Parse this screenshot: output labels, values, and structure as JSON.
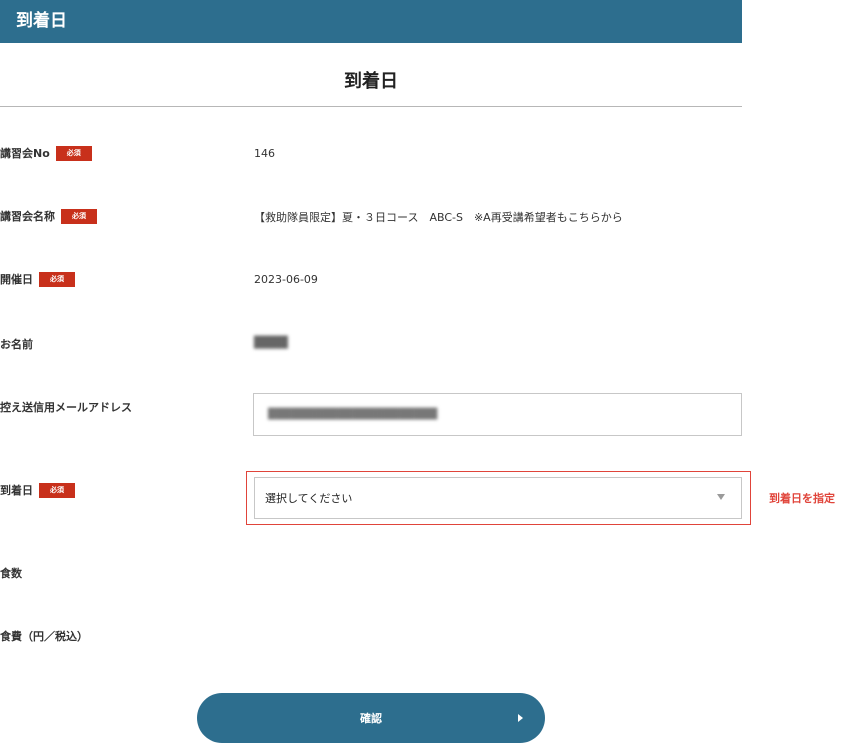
{
  "header": {
    "title": "到着日"
  },
  "page": {
    "heading": "到着日"
  },
  "required_badge": "必須",
  "rows": {
    "seminar_no": {
      "label": "講習会No",
      "value": "146"
    },
    "seminar_name": {
      "label": "講習会名称",
      "value": "【救助隊員限定】夏・３日コース　ABC-S　※A再受講希望者もこちらから"
    },
    "date": {
      "label": "開催日",
      "value": "2023-06-09"
    },
    "name": {
      "label": "お名前",
      "value": "████"
    },
    "email": {
      "label": "控え送信用メールアドレス",
      "value": "██████████████████████"
    },
    "arrival": {
      "label": "到着日",
      "select_value": "選択してください",
      "annotation": "到着日を指定"
    },
    "meals": {
      "label": "食数"
    },
    "meal_cost": {
      "label": "食費（円／税込）"
    }
  },
  "actions": {
    "confirm_label": "確認"
  },
  "colors": {
    "brand": "#2d6e8e",
    "required": "#c8301b",
    "annotation": "#e0443a"
  }
}
